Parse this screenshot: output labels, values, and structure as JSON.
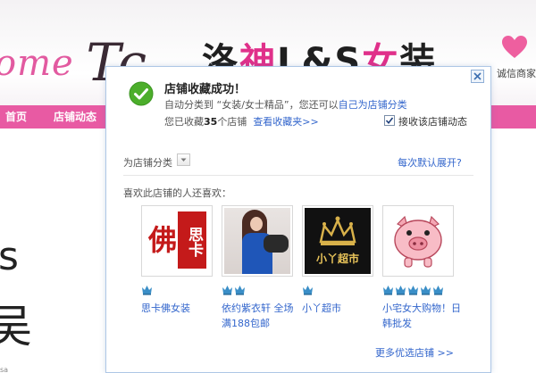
{
  "background": {
    "banner_script": "ome",
    "banner_script_big": "Tc",
    "banner_title_a": "洛",
    "banner_title_b": "神",
    "banner_title_c": "L&S",
    "banner_title_d": "女",
    "banner_title_e": "装",
    "trust_text": "诚信商家",
    "nav": [
      "首页",
      "店铺动态"
    ],
    "side_char_1": "s",
    "side_char_2": "吴",
    "side_small": "sa"
  },
  "popup": {
    "title": "店铺收藏成功！",
    "line2_prefix": "自动分类到 “女装/女士精品”，您还可以",
    "line2_link": "自己为店铺分类",
    "line3_prefix": "您已收藏",
    "line3_count": "35",
    "line3_suffix": "个店铺",
    "line3_link": "查看收藏夹>>",
    "checkbox_label": "接收该店铺动态",
    "checkbox_checked": true,
    "category_label": "为店铺分类",
    "default_expand": "每次默认展开?",
    "like_title": "喜欢此店铺的人还喜欢：",
    "shops": [
      {
        "name": "思卡佛女装",
        "crowns": 1,
        "logo_text_a": "佛",
        "logo_text_b": "思卡"
      },
      {
        "name": "依约紫衣轩 全场满188包邮",
        "crowns": 2
      },
      {
        "name": "小丫超市",
        "crowns": 1,
        "logo_text": "小丫超市"
      },
      {
        "name": "小宅女大购物！日韩批发",
        "crowns": 5
      }
    ],
    "more_link": "更多优选店铺 >>"
  },
  "colors": {
    "nav_pink": "#e85aa3",
    "link_blue": "#3366cc",
    "success_green": "#4cae2b",
    "crown_blue": "#3a8ec7"
  }
}
